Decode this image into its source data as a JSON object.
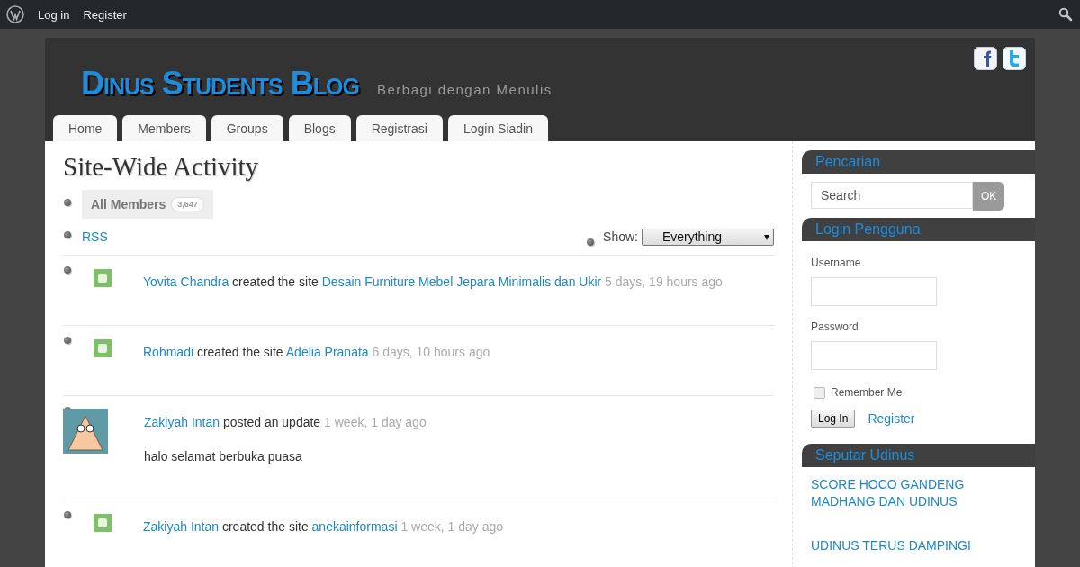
{
  "admin_bar": {
    "links": [
      "Log in",
      "Register"
    ]
  },
  "header": {
    "site_title": "Dinus Students Blog",
    "tagline": "Berbagi dengan Menulis"
  },
  "nav": {
    "tabs": [
      {
        "label": "Home",
        "selected": false
      },
      {
        "label": "Members",
        "selected": false
      },
      {
        "label": "Groups",
        "selected": false
      },
      {
        "label": "Blogs",
        "selected": false
      },
      {
        "label": "Registrasi",
        "selected": false
      },
      {
        "label": "Login Siadin",
        "selected": false
      }
    ]
  },
  "main": {
    "title": "Site-Wide Activity",
    "filters": [
      {
        "label": "All Members",
        "count": "3,647",
        "selected": true
      }
    ],
    "rss": "RSS",
    "show_label": "Show:",
    "show_value": "— Everything —",
    "show_caret": "▾",
    "activities": [
      {
        "kind": "small",
        "actor": "Yovita Chandra",
        "action": "created the site",
        "object": "Desain Furniture Mebel Jepara Minimalis dan Ukir",
        "time": "5 days, 19 hours ago"
      },
      {
        "kind": "small",
        "actor": "Rohmadi",
        "action": "created the site",
        "object": "Adelia Pranata",
        "time": "6 days, 10 hours ago"
      },
      {
        "kind": "large",
        "actor": "Zakiyah Intan",
        "action": "posted an update",
        "time": "1 week, 1 day ago",
        "content": "halo selamat berbuka puasa"
      },
      {
        "kind": "small",
        "actor": "Zakiyah Intan",
        "action": "created the site",
        "object": "anekainformasi",
        "time": "1 week, 1 day ago"
      }
    ]
  },
  "sidebar": {
    "search": {
      "title": "Pencarian",
      "placeholder": "Search",
      "button": "OK"
    },
    "login": {
      "title": "Login Pengguna",
      "username_label": "Username",
      "password_label": "Password",
      "remember_label": "Remember Me",
      "remember_checked": false,
      "login_button": "Log In",
      "register_link": "Register"
    },
    "news": {
      "title": "Seputar Udinus",
      "items": [
        "SCORE HOCO GANDENG MADHANG DAN UDINUS",
        "UDINUS TERUS DAMPINGI"
      ]
    }
  }
}
